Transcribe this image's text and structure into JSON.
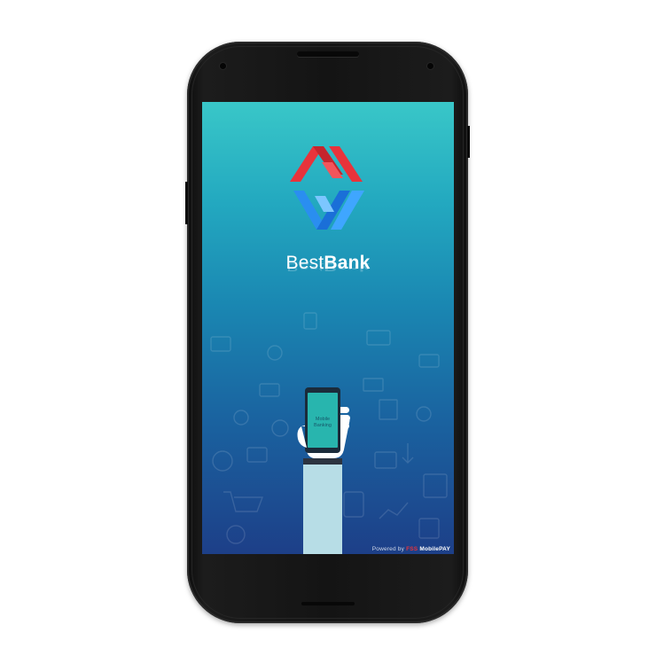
{
  "app": {
    "brand_light": "Best",
    "brand_bold": "Bank",
    "phone_screen_label_1": "Mobile",
    "phone_screen_label_2": "Banking",
    "footer_powered": "Powered by",
    "footer_fss": "FSS",
    "footer_mobilepay": "MobilePAY"
  },
  "colors": {
    "logo_red": "#e8333b",
    "logo_blue": "#2a8ef0",
    "gradient_top": "#39c7c8",
    "gradient_bottom": "#1d3f88",
    "phone_body": "#141414"
  },
  "icons": [
    "bank-logo-icon",
    "hand-holding-phone-icon",
    "dollar-bag-icon",
    "shopping-cart-icon",
    "calendar-icon",
    "money-bill-icon",
    "gear-icon",
    "satellite-dish-icon",
    "clock-icon",
    "wallet-icon",
    "atm-icon"
  ]
}
